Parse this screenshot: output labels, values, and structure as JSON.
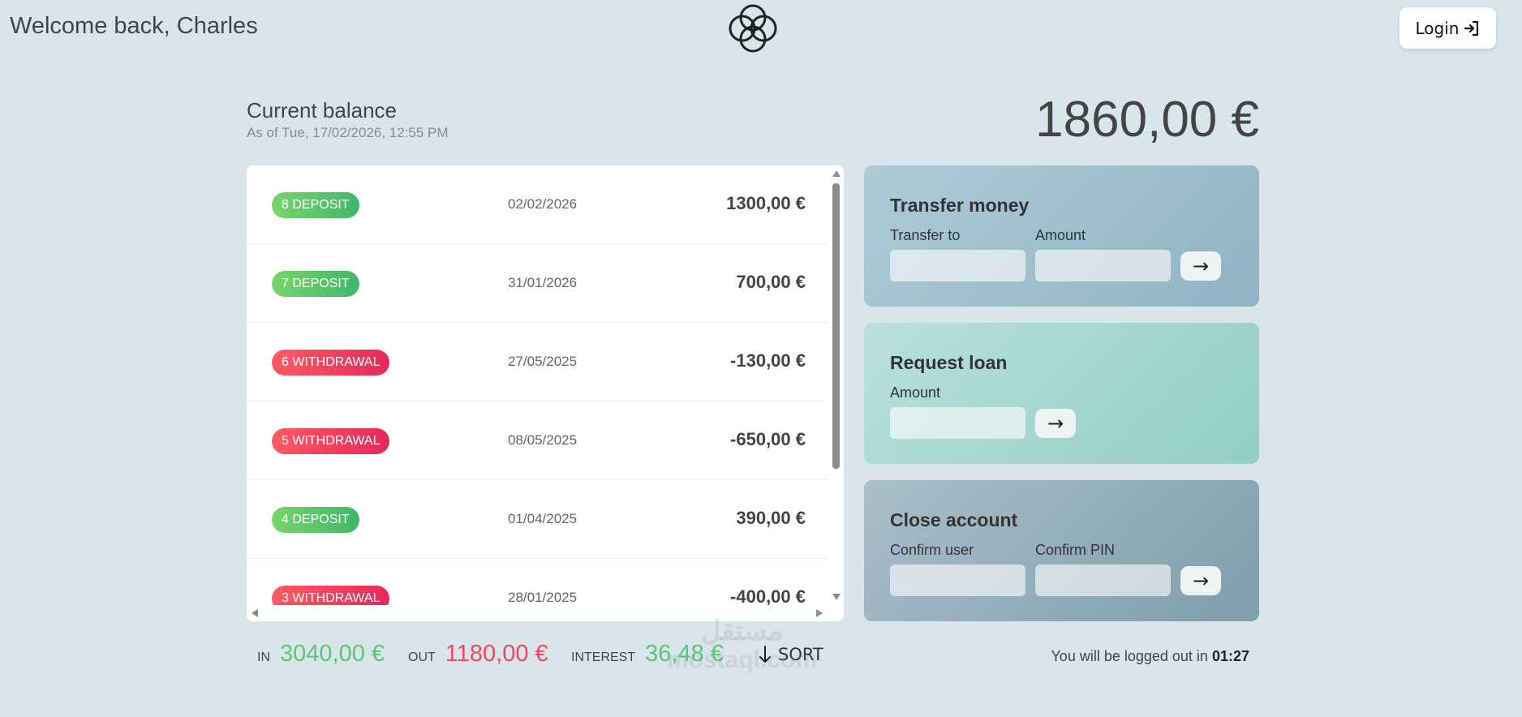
{
  "header": {
    "welcome": "Welcome back, Charles",
    "login_label": "Login",
    "logo_icon": "interlocking-circles-logo",
    "login_icon": "sign-in-icon"
  },
  "balance": {
    "label": "Current balance",
    "date": "As of Tue, 17/02/2026, 12:55 PM",
    "value": "1860,00 €"
  },
  "movements": [
    {
      "type_label": "8 DEPOSIT",
      "type": "deposit",
      "date": "02/02/2026",
      "value": "1300,00 €"
    },
    {
      "type_label": "7 DEPOSIT",
      "type": "deposit",
      "date": "31/01/2026",
      "value": "700,00 €"
    },
    {
      "type_label": "6 WITHDRAWAL",
      "type": "withdrawal",
      "date": "27/05/2025",
      "value": "-130,00 €"
    },
    {
      "type_label": "5 WITHDRAWAL",
      "type": "withdrawal",
      "date": "08/05/2025",
      "value": "-650,00 €"
    },
    {
      "type_label": "4 DEPOSIT",
      "type": "deposit",
      "date": "01/04/2025",
      "value": "390,00 €"
    },
    {
      "type_label": "3 WITHDRAWAL",
      "type": "withdrawal",
      "date": "28/01/2025",
      "value": "-400,00 €"
    }
  ],
  "operations": {
    "transfer": {
      "title": "Transfer money",
      "to_label": "Transfer to",
      "amount_label": "Amount",
      "button": "→"
    },
    "loan": {
      "title": "Request loan",
      "amount_label": "Amount",
      "button": "→"
    },
    "close": {
      "title": "Close account",
      "user_label": "Confirm user",
      "pin_label": "Confirm PIN",
      "button": "→"
    }
  },
  "summary": {
    "in_label": "IN",
    "in_value": "3040,00 €",
    "out_label": "OUT",
    "out_value": "1180,00 €",
    "interest_label": "INTEREST",
    "interest_value": "36,48 €",
    "sort_label": "SORT",
    "sort_icon": "arrow-down-icon"
  },
  "logout": {
    "text": "You will be logged out in",
    "timer": "01:27"
  },
  "watermark": {
    "arabic": "مستقل",
    "latin": "mostaql.com"
  },
  "colors": {
    "background": "#d8e6eb",
    "deposit": "#5ec576",
    "withdrawal": "#f5465d"
  }
}
